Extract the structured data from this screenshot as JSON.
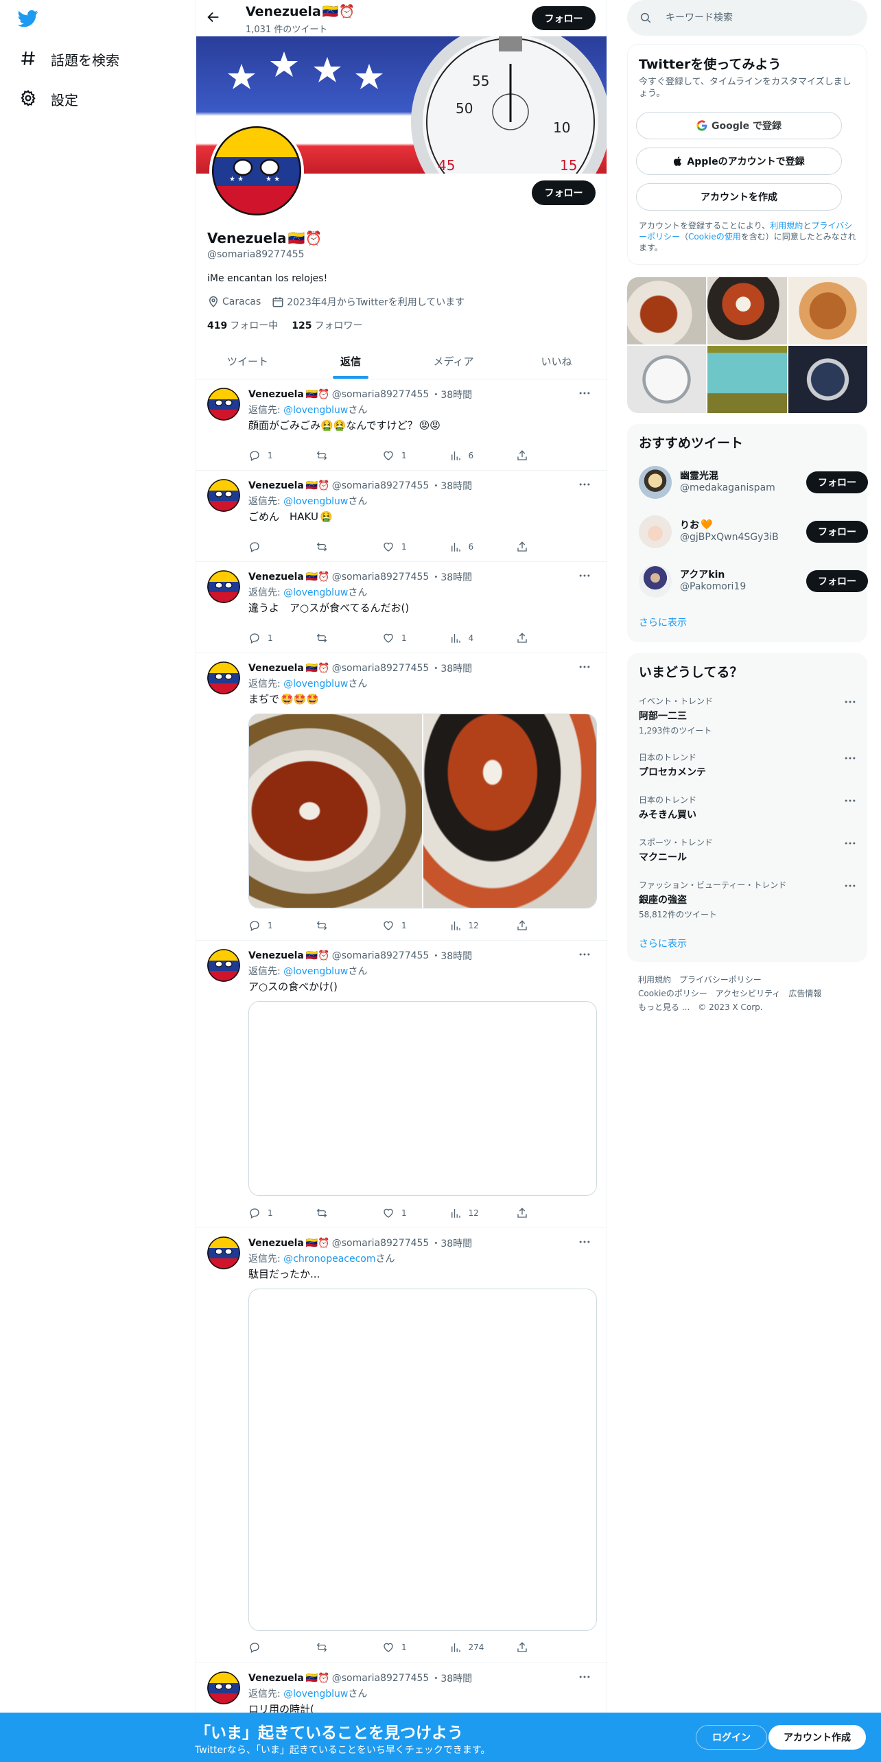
{
  "nav": {
    "explore_label": "話題を検索",
    "settings_label": "設定"
  },
  "header": {
    "name": "Venezuela",
    "emoji": "🇻🇪⏰",
    "tweet_count": "1,031 件のツイート",
    "follow_label": "フォロー"
  },
  "profile": {
    "name": "Venezuela",
    "emoji": "🇻🇪⏰",
    "handle": "@somaria89277455",
    "bio": "iMe encantan los relojes!",
    "location": "Caracas",
    "joined": "2023年4月からTwitterを利用しています",
    "following_count": "419",
    "following_label": "フォロー中",
    "followers_count": "125",
    "followers_label": "フォロワー",
    "follow_label": "フォロー"
  },
  "tabs": [
    {
      "label": "ツイート"
    },
    {
      "label": "返信"
    },
    {
      "label": "メディア"
    },
    {
      "label": "いいね"
    }
  ],
  "tweets": [
    {
      "name": "Venezuela",
      "emoji": "🇻🇪⏰",
      "handle": "@somaria89277455",
      "time": "・38時間",
      "reply_prefix": "返信先: ",
      "reply_to": "@lovengbluw",
      "reply_suffix": "さん",
      "text": "顔面がごみごみ🤮🤮なんですけど？",
      "text_emoji": "😡😡",
      "replies": "1",
      "retweets": "",
      "likes": "1",
      "views": "6"
    },
    {
      "name": "Venezuela",
      "emoji": "🇻🇪⏰",
      "handle": "@somaria89277455",
      "time": "・38時間",
      "reply_prefix": "返信先: ",
      "reply_to": "@lovengbluw",
      "reply_suffix": "さん",
      "text": "ごめん　HAKU",
      "text_emoji": "🤮",
      "replies": "",
      "retweets": "",
      "likes": "1",
      "views": "6"
    },
    {
      "name": "Venezuela",
      "emoji": "🇻🇪⏰",
      "handle": "@somaria89277455",
      "time": "・38時間",
      "reply_prefix": "返信先: ",
      "reply_to": "@lovengbluw",
      "reply_suffix": "さん",
      "text": "違うよ　ア○スが食べてるんだお()",
      "text_emoji": "",
      "replies": "1",
      "retweets": "",
      "likes": "1",
      "views": "4"
    },
    {
      "name": "Venezuela",
      "emoji": "🇻🇪⏰",
      "handle": "@somaria89277455",
      "time": "・38時間",
      "reply_prefix": "返信先: ",
      "reply_to": "@lovengbluw",
      "reply_suffix": "さん",
      "text": "まぢで",
      "text_emoji": "🤩🤩🤩",
      "replies": "1",
      "retweets": "",
      "likes": "1",
      "views": "12"
    },
    {
      "name": "Venezuela",
      "emoji": "🇻🇪⏰",
      "handle": "@somaria89277455",
      "time": "・38時間",
      "reply_prefix": "返信先: ",
      "reply_to": "@lovengbluw",
      "reply_suffix": "さん",
      "text": "ア○スの食べかけ()",
      "text_emoji": "",
      "replies": "1",
      "retweets": "",
      "likes": "1",
      "views": "12"
    },
    {
      "name": "Venezuela",
      "emoji": "🇻🇪⏰",
      "handle": "@somaria89277455",
      "time": "・38時間",
      "reply_prefix": "返信先: ",
      "reply_to": "@chronopeacecom",
      "reply_suffix": "さん",
      "text": "駄目だったか...",
      "text_emoji": "",
      "replies": "",
      "retweets": "",
      "likes": "1",
      "views": "274"
    },
    {
      "name": "Venezuela",
      "emoji": "🇻🇪⏰",
      "handle": "@somaria89277455",
      "time": "・38時間",
      "reply_prefix": "返信先: ",
      "reply_to": "@lovengbluw",
      "reply_suffix": "さん",
      "text": "ロリ用の時計(",
      "text_emoji": "",
      "replies": "",
      "retweets": "",
      "likes": "",
      "views": ""
    }
  ],
  "search": {
    "placeholder": "キーワード検索"
  },
  "signup": {
    "title": "Twitterを使ってみよう",
    "subtitle": "今すぐ登録して、タイムラインをカスタマイズしましょう。",
    "google": "Google で登録",
    "apple": "Appleのアカウントで登録",
    "create": "アカウントを作成",
    "legal_1": "アカウントを登録することにより、",
    "legal_terms": "利用規約",
    "legal_2": "と",
    "legal_privacy": "プライバシーポリシー",
    "legal_3": "（",
    "legal_cookie": "Cookieの使用",
    "legal_4": "を含む）に同意したとみなされます。"
  },
  "recommended": {
    "title": "おすすめツイート",
    "users": [
      {
        "name": "幽霊光混",
        "name_emoji": "",
        "handle": "@medakaganispam",
        "follow": "フォロー"
      },
      {
        "name": "りお",
        "name_emoji": "🧡",
        "handle": "@gjBPxQwn4SGy3iB",
        "follow": "フォロー"
      },
      {
        "name": "アクアkin",
        "name_emoji": "",
        "handle": "@Pakomori19",
        "follow": "フォロー"
      }
    ],
    "show_more": "さらに表示"
  },
  "trends": {
    "title": "いまどうしてる？",
    "items": [
      {
        "category": "イベント・トレンド",
        "topic": "阿部一二三",
        "count": "1,293件のツイート"
      },
      {
        "category": "日本のトレンド",
        "topic": "プロセカメンテ",
        "count": ""
      },
      {
        "category": "日本のトレンド",
        "topic": "みそきん買い",
        "count": ""
      },
      {
        "category": "スポーツ・トレンド",
        "topic": "マクニール",
        "count": ""
      },
      {
        "category": "ファッション・ビューティー・トレンド",
        "topic": "銀座の強盗",
        "count": "58,812件のツイート"
      }
    ],
    "show_more": "さらに表示"
  },
  "footer": {
    "terms": "利用規約",
    "privacy": "プライバシーポリシー",
    "cookie": "Cookieのポリシー",
    "accessibility": "アクセシビリティ",
    "ads": "広告情報",
    "more": "もっと見る ...",
    "copyright": "© 2023 X Corp."
  },
  "bottombar": {
    "title": "「いま」起きていることを見つけよう",
    "subtitle": "Twitterなら、「いま」起きていることをいち早くチェックできます。",
    "login": "ログイン",
    "signup": "アカウント作成"
  },
  "colors": {
    "accent": "#1d9bf0",
    "text": "#0f1419",
    "muted": "#536471",
    "venezuela_yellow": "#ffcc00",
    "venezuela_blue": "#1f3a93",
    "venezuela_red": "#cf142b"
  }
}
